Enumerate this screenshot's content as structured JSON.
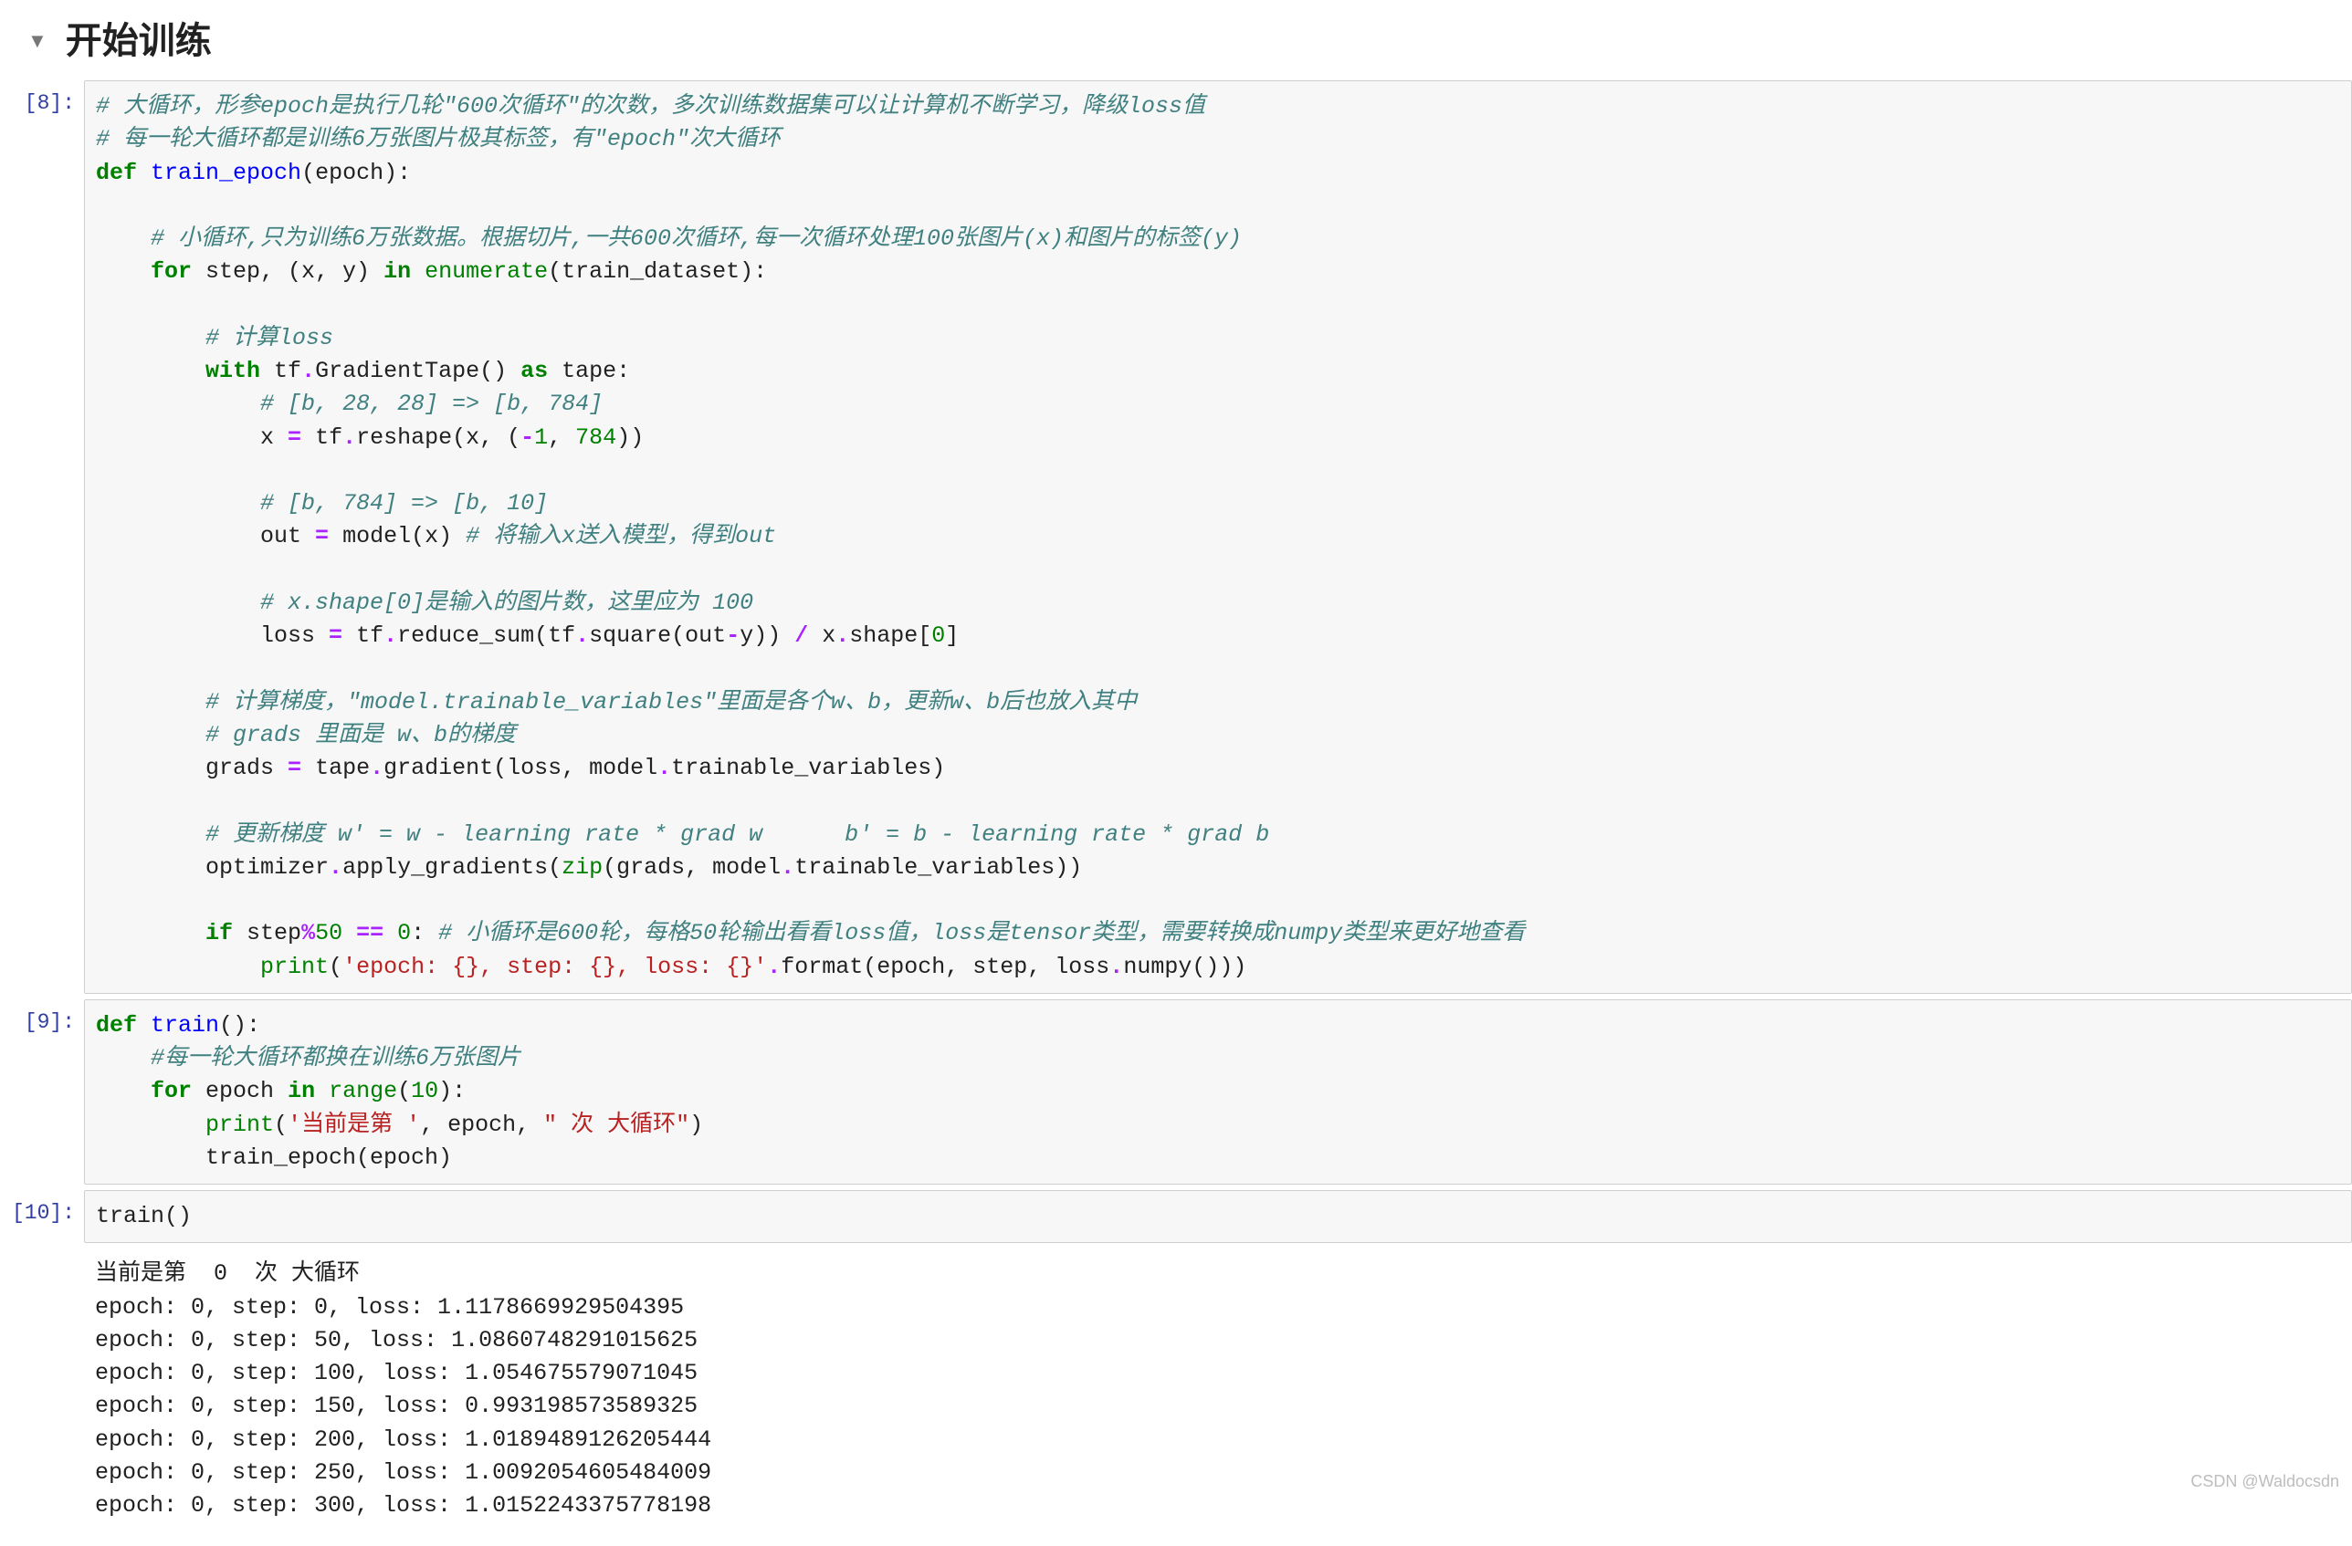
{
  "heading": "开始训练",
  "cells": [
    {
      "prompt": "[8]:",
      "type": "code",
      "tokens": [
        [
          [
            "cm",
            "# 大循环，形参epoch是执行几轮\"600次循环\"的次数，多次训练数据集可以让计算机不断学习，降级loss值"
          ]
        ],
        [
          [
            "cm",
            "# 每一轮大循环都是训练6万张图片极其标签，有\"epoch\"次大循环"
          ]
        ],
        [
          [
            "kw",
            "def"
          ],
          [
            "pl",
            " "
          ],
          [
            "nf",
            "train_epoch"
          ],
          [
            "pl",
            "(epoch):"
          ]
        ],
        [
          [
            "pl",
            ""
          ]
        ],
        [
          [
            "pl",
            "    "
          ],
          [
            "cm",
            "# 小循环,只为训练6万张数据。根据切片,一共600次循环,每一次循环处理100张图片(x)和图片的标签(y)"
          ]
        ],
        [
          [
            "pl",
            "    "
          ],
          [
            "kw",
            "for"
          ],
          [
            "pl",
            " step, (x, y) "
          ],
          [
            "kw",
            "in"
          ],
          [
            "pl",
            " "
          ],
          [
            "nb",
            "enumerate"
          ],
          [
            "pl",
            "(train_dataset):"
          ]
        ],
        [
          [
            "pl",
            ""
          ]
        ],
        [
          [
            "pl",
            "        "
          ],
          [
            "cm",
            "# 计算loss"
          ]
        ],
        [
          [
            "pl",
            "        "
          ],
          [
            "kw",
            "with"
          ],
          [
            "pl",
            " tf"
          ],
          [
            "dot",
            "."
          ],
          [
            "pl",
            "GradientTape() "
          ],
          [
            "kw",
            "as"
          ],
          [
            "pl",
            " tape:"
          ]
        ],
        [
          [
            "pl",
            "            "
          ],
          [
            "cm",
            "# [b, 28, 28] => [b, 784]"
          ]
        ],
        [
          [
            "pl",
            "            x "
          ],
          [
            "op",
            "="
          ],
          [
            "pl",
            " tf"
          ],
          [
            "dot",
            "."
          ],
          [
            "pl",
            "reshape(x, ("
          ],
          [
            "op",
            "-"
          ],
          [
            "num",
            "1"
          ],
          [
            "pl",
            ", "
          ],
          [
            "num",
            "784"
          ],
          [
            "pl",
            "))"
          ]
        ],
        [
          [
            "pl",
            ""
          ]
        ],
        [
          [
            "pl",
            "            "
          ],
          [
            "cm",
            "# [b, 784] => [b, 10]"
          ]
        ],
        [
          [
            "pl",
            "            out "
          ],
          [
            "op",
            "="
          ],
          [
            "pl",
            " model(x) "
          ],
          [
            "cm",
            "# 将输入x送入模型，得到out"
          ]
        ],
        [
          [
            "pl",
            ""
          ]
        ],
        [
          [
            "pl",
            "            "
          ],
          [
            "cm",
            "# x.shape[0]是输入的图片数，这里应为 100"
          ]
        ],
        [
          [
            "pl",
            "            loss "
          ],
          [
            "op",
            "="
          ],
          [
            "pl",
            " tf"
          ],
          [
            "dot",
            "."
          ],
          [
            "pl",
            "reduce_sum(tf"
          ],
          [
            "dot",
            "."
          ],
          [
            "pl",
            "square(out"
          ],
          [
            "op",
            "-"
          ],
          [
            "pl",
            "y)) "
          ],
          [
            "op",
            "/"
          ],
          [
            "pl",
            " x"
          ],
          [
            "dot",
            "."
          ],
          [
            "pl",
            "shape["
          ],
          [
            "num",
            "0"
          ],
          [
            "pl",
            "]"
          ]
        ],
        [
          [
            "pl",
            ""
          ]
        ],
        [
          [
            "pl",
            "        "
          ],
          [
            "cm",
            "# 计算梯度，\"model.trainable_variables\"里面是各个w、b，更新w、b后也放入其中"
          ]
        ],
        [
          [
            "pl",
            "        "
          ],
          [
            "cm",
            "# grads 里面是 w、b的梯度"
          ]
        ],
        [
          [
            "pl",
            "        grads "
          ],
          [
            "op",
            "="
          ],
          [
            "pl",
            " tape"
          ],
          [
            "dot",
            "."
          ],
          [
            "pl",
            "gradient(loss, model"
          ],
          [
            "dot",
            "."
          ],
          [
            "pl",
            "trainable_variables)"
          ]
        ],
        [
          [
            "pl",
            ""
          ]
        ],
        [
          [
            "pl",
            "        "
          ],
          [
            "cm",
            "# 更新梯度 w' = w - learning rate * grad w      b' = b - learning rate * grad b"
          ]
        ],
        [
          [
            "pl",
            "        optimizer"
          ],
          [
            "dot",
            "."
          ],
          [
            "pl",
            "apply_gradients("
          ],
          [
            "nb",
            "zip"
          ],
          [
            "pl",
            "(grads, model"
          ],
          [
            "dot",
            "."
          ],
          [
            "pl",
            "trainable_variables))"
          ]
        ],
        [
          [
            "pl",
            ""
          ]
        ],
        [
          [
            "pl",
            "        "
          ],
          [
            "kw",
            "if"
          ],
          [
            "pl",
            " step"
          ],
          [
            "op",
            "%"
          ],
          [
            "num",
            "50"
          ],
          [
            "pl",
            " "
          ],
          [
            "op",
            "=="
          ],
          [
            "pl",
            " "
          ],
          [
            "num",
            "0"
          ],
          [
            "pl",
            ": "
          ],
          [
            "cm",
            "# 小循环是600轮，每格50轮输出看看loss值，loss是tensor类型，需要转换成numpy类型来更好地查看"
          ]
        ],
        [
          [
            "pl",
            "            "
          ],
          [
            "nb",
            "print"
          ],
          [
            "pl",
            "("
          ],
          [
            "str",
            "'epoch: "
          ],
          [
            "strd",
            "{}"
          ],
          [
            "str",
            ", step: "
          ],
          [
            "strd",
            "{}"
          ],
          [
            "str",
            ", loss: "
          ],
          [
            "strd",
            "{}"
          ],
          [
            "str",
            "'"
          ],
          [
            "dot",
            "."
          ],
          [
            "pl",
            "format(epoch, step, loss"
          ],
          [
            "dot",
            "."
          ],
          [
            "pl",
            "numpy()))"
          ]
        ]
      ]
    },
    {
      "prompt": "[9]:",
      "type": "code",
      "tokens": [
        [
          [
            "kw",
            "def"
          ],
          [
            "pl",
            " "
          ],
          [
            "nf",
            "train"
          ],
          [
            "pl",
            "():"
          ]
        ],
        [
          [
            "pl",
            "    "
          ],
          [
            "cm",
            "#每一轮大循环都换在训练6万张图片"
          ]
        ],
        [
          [
            "pl",
            "    "
          ],
          [
            "kw",
            "for"
          ],
          [
            "pl",
            " epoch "
          ],
          [
            "kw",
            "in"
          ],
          [
            "pl",
            " "
          ],
          [
            "nb",
            "range"
          ],
          [
            "pl",
            "("
          ],
          [
            "num",
            "10"
          ],
          [
            "pl",
            "):"
          ]
        ],
        [
          [
            "pl",
            "        "
          ],
          [
            "nb",
            "print"
          ],
          [
            "pl",
            "("
          ],
          [
            "str",
            "'当前是第 '"
          ],
          [
            "pl",
            ", epoch, "
          ],
          [
            "str",
            "\" 次 大循环\""
          ],
          [
            "pl",
            ")"
          ]
        ],
        [
          [
            "pl",
            "        train_epoch(epoch)"
          ]
        ]
      ]
    },
    {
      "prompt": "[10]:",
      "type": "code",
      "tokens": [
        [
          [
            "pl",
            "train()"
          ]
        ]
      ]
    },
    {
      "prompt": "",
      "type": "output",
      "text": "当前是第  0  次 大循环\nepoch: 0, step: 0, loss: 1.1178669929504395\nepoch: 0, step: 50, loss: 1.0860748291015625\nepoch: 0, step: 100, loss: 1.054675579071045\nepoch: 0, step: 150, loss: 0.993198573589325\nepoch: 0, step: 200, loss: 1.0189489126205444\nepoch: 0, step: 250, loss: 1.0092054605484009\nepoch: 0, step: 300, loss: 1.0152243375778198"
    }
  ],
  "watermark": "CSDN @Waldocsdn"
}
